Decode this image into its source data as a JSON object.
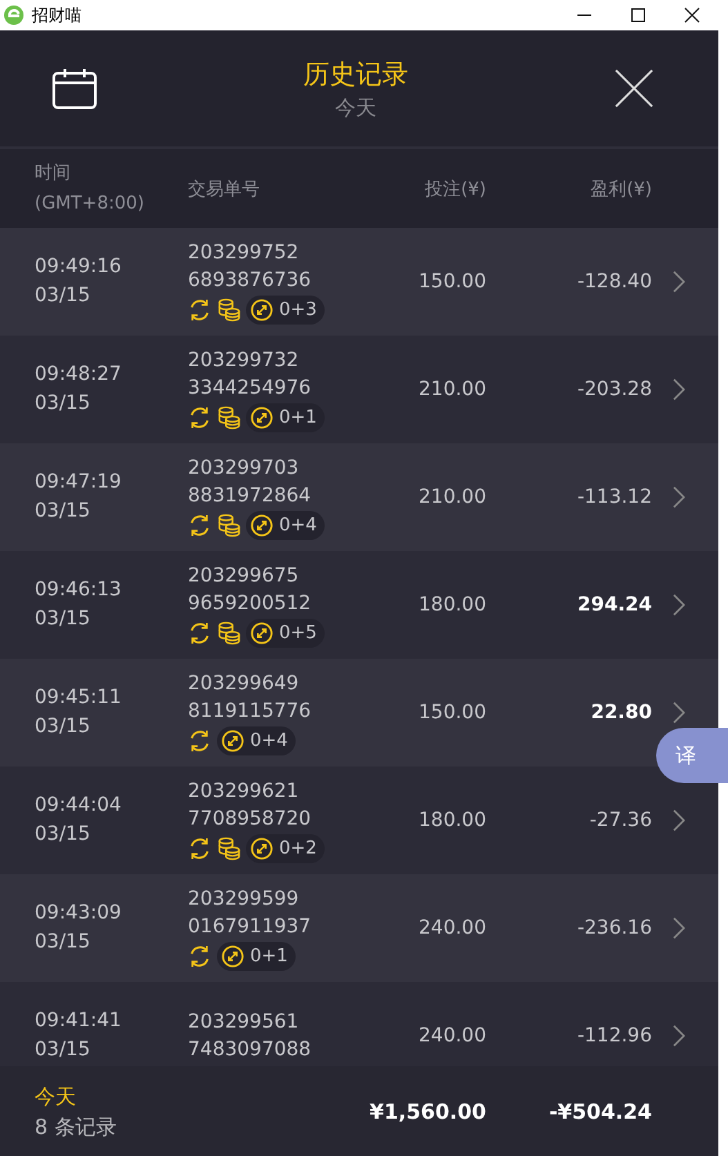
{
  "window": {
    "title": "招财喵"
  },
  "header": {
    "title": "历史记录",
    "subtitle": "今天"
  },
  "columns": [
    {
      "label": "时间",
      "sublabel": "(GMT+8:00)"
    },
    {
      "label": "交易单号"
    },
    {
      "label": "投注(¥)"
    },
    {
      "label": "盈利(¥)"
    }
  ],
  "rows": [
    {
      "time": "09:49:16",
      "date": "03/15",
      "order": [
        "203299752",
        "6893876736"
      ],
      "icons": [
        {
          "kind": "refresh"
        },
        {
          "kind": "coins"
        }
      ],
      "badge": "0+3",
      "bet": "150.00",
      "profit": "-128.40",
      "positive": false
    },
    {
      "time": "09:48:27",
      "date": "03/15",
      "order": [
        "203299732",
        "3344254976"
      ],
      "icons": [
        {
          "kind": "refresh"
        },
        {
          "kind": "coins"
        }
      ],
      "badge": "0+1",
      "bet": "210.00",
      "profit": "-203.28",
      "positive": false
    },
    {
      "time": "09:47:19",
      "date": "03/15",
      "order": [
        "203299703",
        "8831972864"
      ],
      "icons": [
        {
          "kind": "refresh"
        },
        {
          "kind": "coins"
        }
      ],
      "badge": "0+4",
      "bet": "210.00",
      "profit": "-113.12",
      "positive": false
    },
    {
      "time": "09:46:13",
      "date": "03/15",
      "order": [
        "203299675",
        "9659200512"
      ],
      "icons": [
        {
          "kind": "refresh"
        },
        {
          "kind": "coins"
        }
      ],
      "badge": "0+5",
      "bet": "180.00",
      "profit": "294.24",
      "positive": true
    },
    {
      "time": "09:45:11",
      "date": "03/15",
      "order": [
        "203299649",
        "8119115776"
      ],
      "icons": [
        {
          "kind": "refresh"
        }
      ],
      "badge": "0+4",
      "bet": "150.00",
      "profit": "22.80",
      "positive": true
    },
    {
      "time": "09:44:04",
      "date": "03/15",
      "order": [
        "203299621",
        "7708958720"
      ],
      "icons": [
        {
          "kind": "refresh"
        },
        {
          "kind": "coins"
        }
      ],
      "badge": "0+2",
      "bet": "180.00",
      "profit": "-27.36",
      "positive": false
    },
    {
      "time": "09:43:09",
      "date": "03/15",
      "order": [
        "203299599",
        "0167911937"
      ],
      "icons": [
        {
          "kind": "refresh"
        }
      ],
      "badge": "0+1",
      "bet": "240.00",
      "profit": "-236.16",
      "positive": false
    },
    {
      "time": "09:41:41",
      "date": "03/15",
      "order": [
        "203299561",
        "7483097088"
      ],
      "bet": "240.00",
      "profit": "-112.96",
      "positive": false
    }
  ],
  "footer": {
    "period": "今天",
    "count": "8 条记录",
    "total_bet": "¥1,560.00",
    "total_profit": "-¥504.24"
  },
  "translate_button": "译"
}
